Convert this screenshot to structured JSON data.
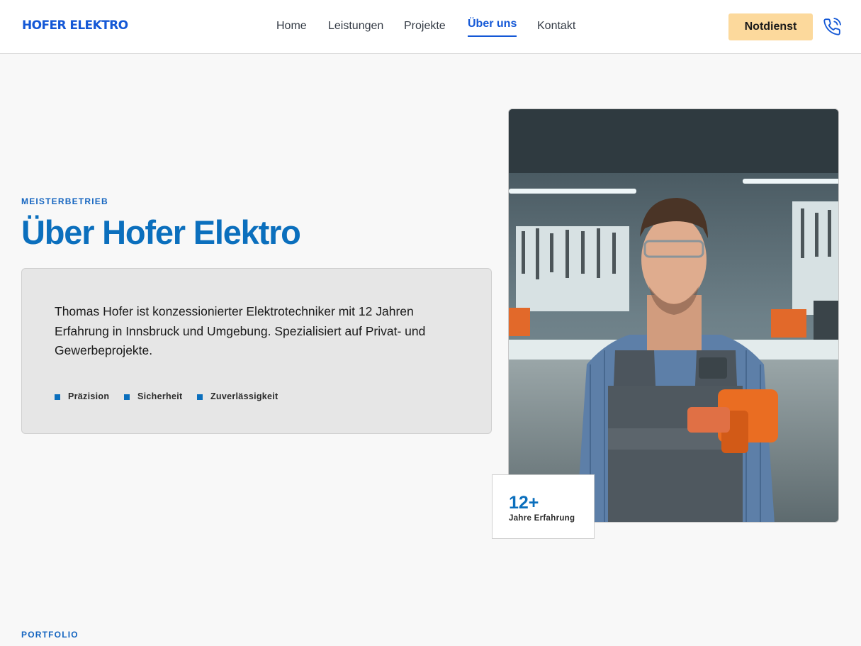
{
  "header": {
    "logo": "HOFER ELEKTRO",
    "nav": [
      {
        "label": "Home",
        "active": false
      },
      {
        "label": "Leistungen",
        "active": false
      },
      {
        "label": "Projekte",
        "active": false
      },
      {
        "label": "Über uns",
        "active": true
      },
      {
        "label": "Kontakt",
        "active": false
      }
    ],
    "cta_label": "Notdienst",
    "phone_icon": "phone-icon"
  },
  "about": {
    "eyebrow": "MEISTERBETRIEB",
    "title": "Über Hofer Elektro",
    "description": "Thomas Hofer ist konzessionierter Elektrotechniker mit 12 Jahren Erfahrung in Innsbruck und Umgebung. Spezialisiert auf Privat- und Gewerbeprojekte.",
    "values": [
      "Präzision",
      "Sicherheit",
      "Zuverlässigkeit"
    ],
    "stat": {
      "value": "12+",
      "label": "Jahre Erfahrung"
    }
  },
  "portfolio": {
    "eyebrow": "PORTFOLIO"
  },
  "colors": {
    "brand": "#1458d6",
    "accent": "#0b6fbd",
    "cta_background": "#fcd99c",
    "page_background": "#f8f8f8",
    "card_background": "#e6e6e6"
  }
}
